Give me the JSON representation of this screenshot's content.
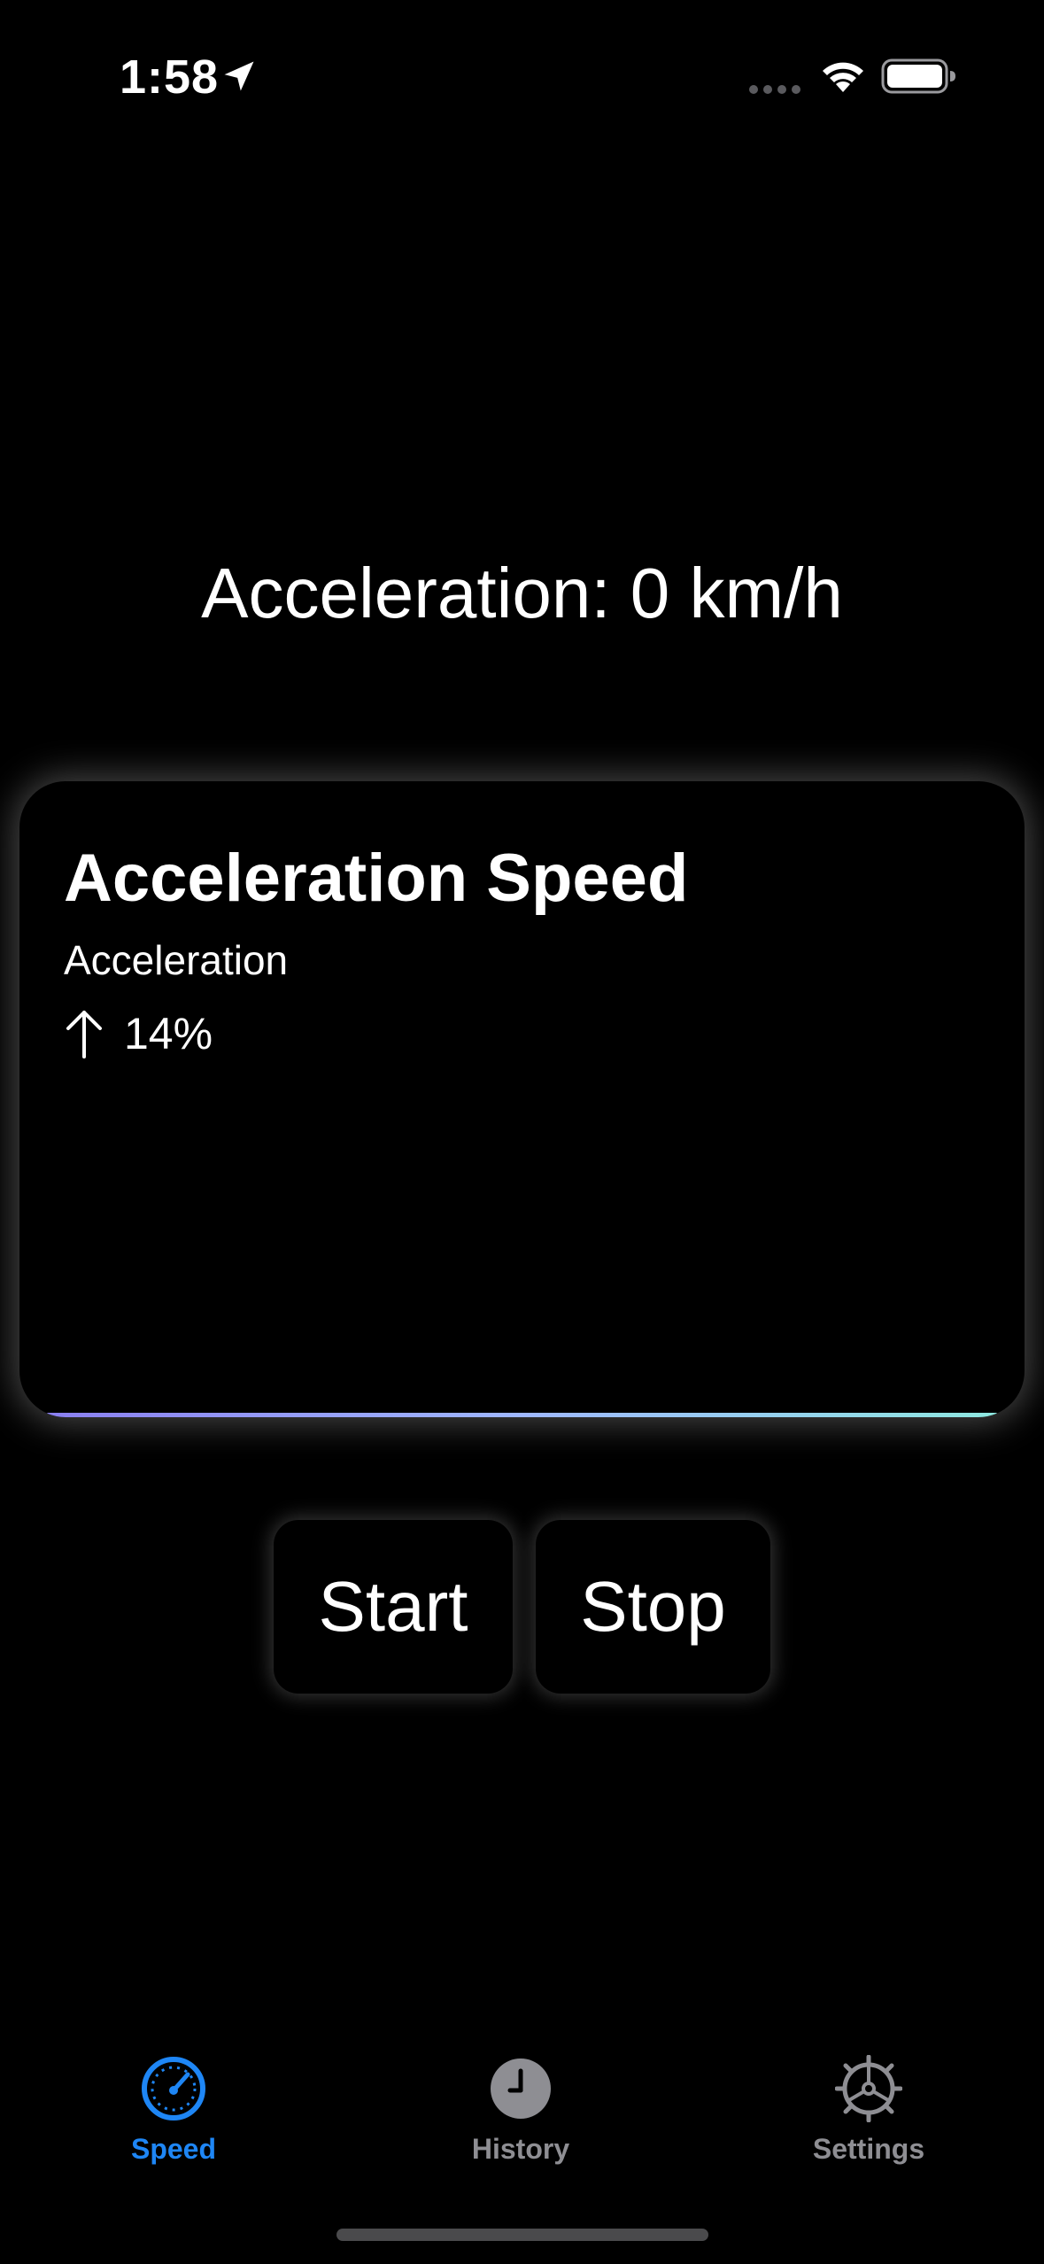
{
  "status_bar": {
    "time": "1:58",
    "icons": [
      "location-arrow-icon",
      "signal-dots-icon",
      "wifi-icon",
      "battery-icon"
    ]
  },
  "readout": {
    "text": "Acceleration: 0 km/h"
  },
  "card": {
    "title": "Acceleration Speed",
    "label": "Acceleration",
    "metric_icon": "arrow-up-icon",
    "metric_value": "14%",
    "accent_gradient": [
      "#8a7ff0",
      "#9fb8ff",
      "#8ee8e0"
    ]
  },
  "buttons": {
    "start_label": "Start",
    "stop_label": "Stop"
  },
  "tab_bar": {
    "active_color": "#1e86f5",
    "inactive_color": "#8e8e93",
    "tabs": [
      {
        "label": "Speed",
        "icon": "speedometer-icon",
        "active": true
      },
      {
        "label": "History",
        "icon": "clock-icon",
        "active": false
      },
      {
        "label": "Settings",
        "icon": "gear-icon",
        "active": false
      }
    ]
  }
}
